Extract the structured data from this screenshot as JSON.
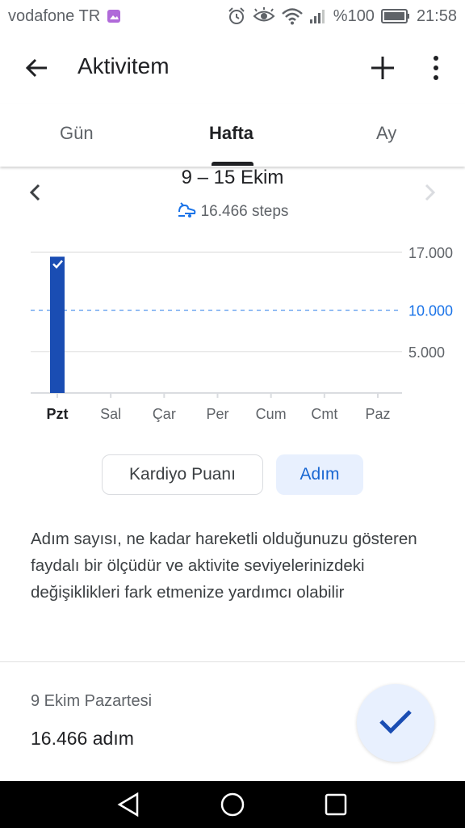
{
  "status_bar": {
    "carrier": "vodafone TR",
    "battery": "%100",
    "time": "21:58",
    "icons": [
      "image-icon",
      "alarm-icon",
      "eye-icon",
      "wifi-icon",
      "signal-icon",
      "battery-icon"
    ]
  },
  "app_bar": {
    "title": "Aktivitem",
    "icons": [
      "back-arrow-icon",
      "add-icon",
      "more-vert-icon"
    ]
  },
  "tabs": [
    {
      "label": "Gün",
      "active": false
    },
    {
      "label": "Hafta",
      "active": true
    },
    {
      "label": "Ay",
      "active": false
    }
  ],
  "week": {
    "title": "9 – 15 Ekim",
    "steps_text": "16.466 steps",
    "icons": [
      "prev-chevron-icon",
      "steps-icon",
      "next-chevron-icon"
    ]
  },
  "chart_data": {
    "type": "bar",
    "categories": [
      "Pzt",
      "Sal",
      "Çar",
      "Per",
      "Cum",
      "Cmt",
      "Paz"
    ],
    "values": [
      16466,
      0,
      0,
      0,
      0,
      0,
      0
    ],
    "y_ticks": [
      "17.000",
      "10.000",
      "5.000"
    ],
    "y_tick_values": [
      17000,
      10000,
      5000
    ],
    "goal": 10000,
    "goal_label": "10.000",
    "ylim": [
      0,
      17000
    ],
    "selected_category": "Pzt",
    "bar_color": "#1a4db3",
    "goal_color": "#1a73e8"
  },
  "metric_toggle": {
    "cardio_label": "Kardiyo Puanı",
    "steps_label": "Adım",
    "selected": "Adım"
  },
  "description": "Adım sayısı, ne kadar hareketli olduğunuzu gösteren faydalı bir ölçüdür ve aktivite seviyelerinizdeki değişiklikleri fark etmenize yardımcı olabilir",
  "day_summary": {
    "date": "9 Ekim Pazartesi",
    "steps": "16.466 adım"
  },
  "fab": {
    "icon": "check-icon"
  },
  "nav_bar": {
    "icons": [
      "nav-back-icon",
      "nav-home-icon",
      "nav-recents-icon"
    ]
  }
}
